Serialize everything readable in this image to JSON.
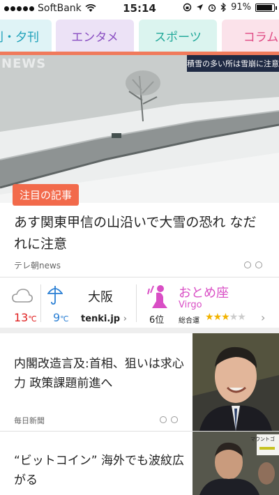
{
  "status_bar": {
    "carrier": "SoftBank",
    "time": "15:14",
    "battery_percent": "91%",
    "battery_level": 0.91
  },
  "tabs": [
    {
      "label": "刊・夕刊",
      "bg": "#dff3f6",
      "color": "#1a9fb8"
    },
    {
      "label": "エンタメ",
      "bg": "#ece2f6",
      "color": "#8a4fc2"
    },
    {
      "label": "スポーツ",
      "bg": "#dbf4ef",
      "color": "#23a99a"
    },
    {
      "label": "コラム",
      "bg": "#fbe2ea",
      "color": "#e04a84"
    }
  ],
  "hero": {
    "logo": "NEWS",
    "ticker": "積雪の多い所は雪崩に注意",
    "badge": "注目の記事",
    "headline": "あす関東甲信の山沿いで大雪の恐れ なだれに注意",
    "source": "テレ朝news"
  },
  "weather": {
    "high": "13",
    "low": "9",
    "unit": "℃",
    "high_color": "#e02020",
    "low_color": "#2a7fd4",
    "city": "大阪",
    "provider": "tenki.jp"
  },
  "horoscope": {
    "sign": "おとめ座",
    "sign_en": "Virgo",
    "rank": "6位",
    "overall_label": "総合運",
    "stars": 3,
    "max_stars": 5
  },
  "articles": [
    {
      "title": "内閣改造言及:首相、狙いは求心力 政策課題前進へ",
      "source": "毎日新聞"
    },
    {
      "title": "“ビットコイン” 海外でも波紋広がる",
      "source": ""
    }
  ],
  "thumb2_caption": "マウントゴ"
}
